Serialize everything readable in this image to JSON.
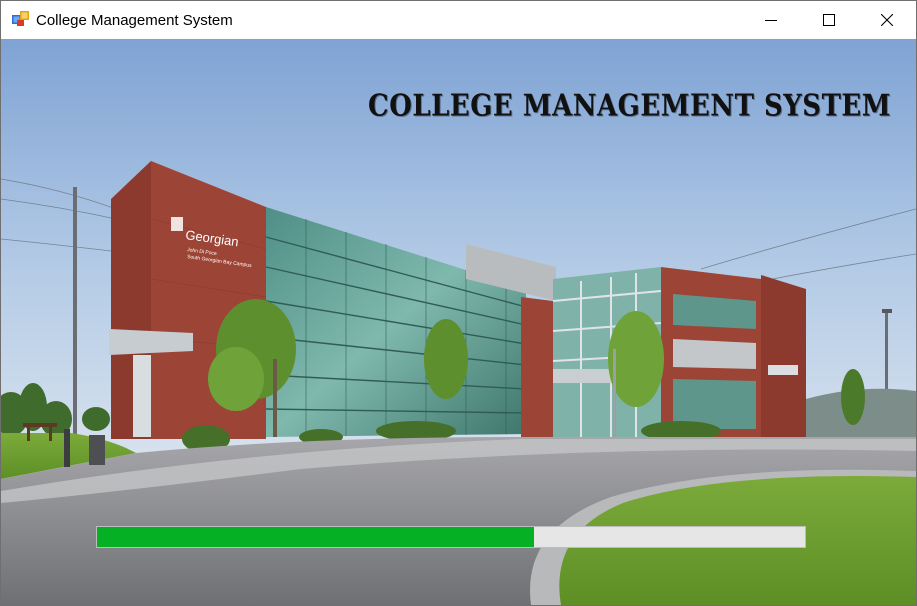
{
  "window": {
    "title": "College Management System",
    "app_icon": "app-icon",
    "controls": [
      "minimize-icon",
      "maximize-icon",
      "close-icon"
    ]
  },
  "splash": {
    "heading": "College Management System",
    "background": "campus-building-photo"
  },
  "progress": {
    "fraction": 0.617,
    "color": "#06b025",
    "track_color": "#e6e6e6"
  }
}
